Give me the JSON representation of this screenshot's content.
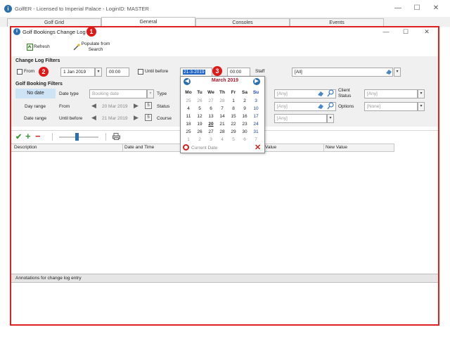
{
  "app": {
    "title": "GolfER - Licensed to Imperial Palace - LoginID: MASTER",
    "logo": "i",
    "window_buttons": [
      "—",
      "☐",
      "✕"
    ]
  },
  "tabs": [
    {
      "label": "Golf Grid",
      "active": false
    },
    {
      "label": "General",
      "active": true
    },
    {
      "label": "Consoles",
      "active": false
    },
    {
      "label": "Events",
      "active": false
    }
  ],
  "child_window": {
    "title": "Golf Bookings Change Log",
    "logo": "i",
    "window_buttons": [
      "—",
      "☐",
      "✕"
    ]
  },
  "badges": [
    "1",
    "2",
    "3"
  ],
  "toolbar": {
    "refresh_label": "Refresh",
    "populate_label_line1": "Populate from",
    "populate_label_line2": "Search"
  },
  "change_log_filters": {
    "title": "Change Log Filters",
    "from_label": "From",
    "from_date": "1 Jan 2019",
    "from_time": "00:00",
    "until_label": "Until before",
    "until_date": "21-3-2019",
    "until_time": "00:00",
    "staff_label": "Staff",
    "staff_value": "[All]"
  },
  "golf_booking_filters": {
    "title": "Golf Booking Filters",
    "no_date": "No date",
    "day_range": "Day range",
    "date_range": "Date range",
    "date_type_label": "Date type",
    "date_type_value": "Booking date",
    "from_label": "From",
    "from_value": "20 Mar 2019",
    "until_before_label": "Until before",
    "until_before_value": "21 Mar 2019",
    "type_label": "Type",
    "status_label": "Status",
    "course_label": "Course",
    "any1": "[Any]",
    "any2": "[Any]",
    "any3": "[Any]",
    "client_status_label_1": "Client",
    "client_status_label_2": "Status",
    "client_status_value": "[Any]",
    "options_label": "Options",
    "options_value": "[None]"
  },
  "calendar": {
    "month": "March 2019",
    "prev_icon": "◀",
    "next_icon": "▶",
    "weekdays": [
      "Mo",
      "Tu",
      "We",
      "Th",
      "Fr",
      "Sa",
      "Su"
    ],
    "weeks": [
      [
        "25",
        "26",
        "27",
        "28",
        "1",
        "2",
        "3"
      ],
      [
        "4",
        "5",
        "6",
        "7",
        "8",
        "9",
        "10"
      ],
      [
        "11",
        "12",
        "13",
        "14",
        "15",
        "16",
        "17"
      ],
      [
        "18",
        "19",
        "20",
        "21",
        "22",
        "23",
        "24"
      ],
      [
        "25",
        "26",
        "27",
        "28",
        "29",
        "30",
        "31"
      ],
      [
        "1",
        "2",
        "3",
        "4",
        "5",
        "6",
        "7"
      ]
    ],
    "today_marker": "20",
    "current_date_label": "Current Date"
  },
  "grid": {
    "columns": [
      "Description",
      "Date and Time",
      "Value",
      "New Value"
    ]
  },
  "annotations_title": "Annotations for change log entry",
  "colors": {
    "highlight_red": "#e02020",
    "accent_blue": "#2a6fb0",
    "calendar_month": "#b0182a",
    "sunday_blue": "#1a3fa8"
  }
}
